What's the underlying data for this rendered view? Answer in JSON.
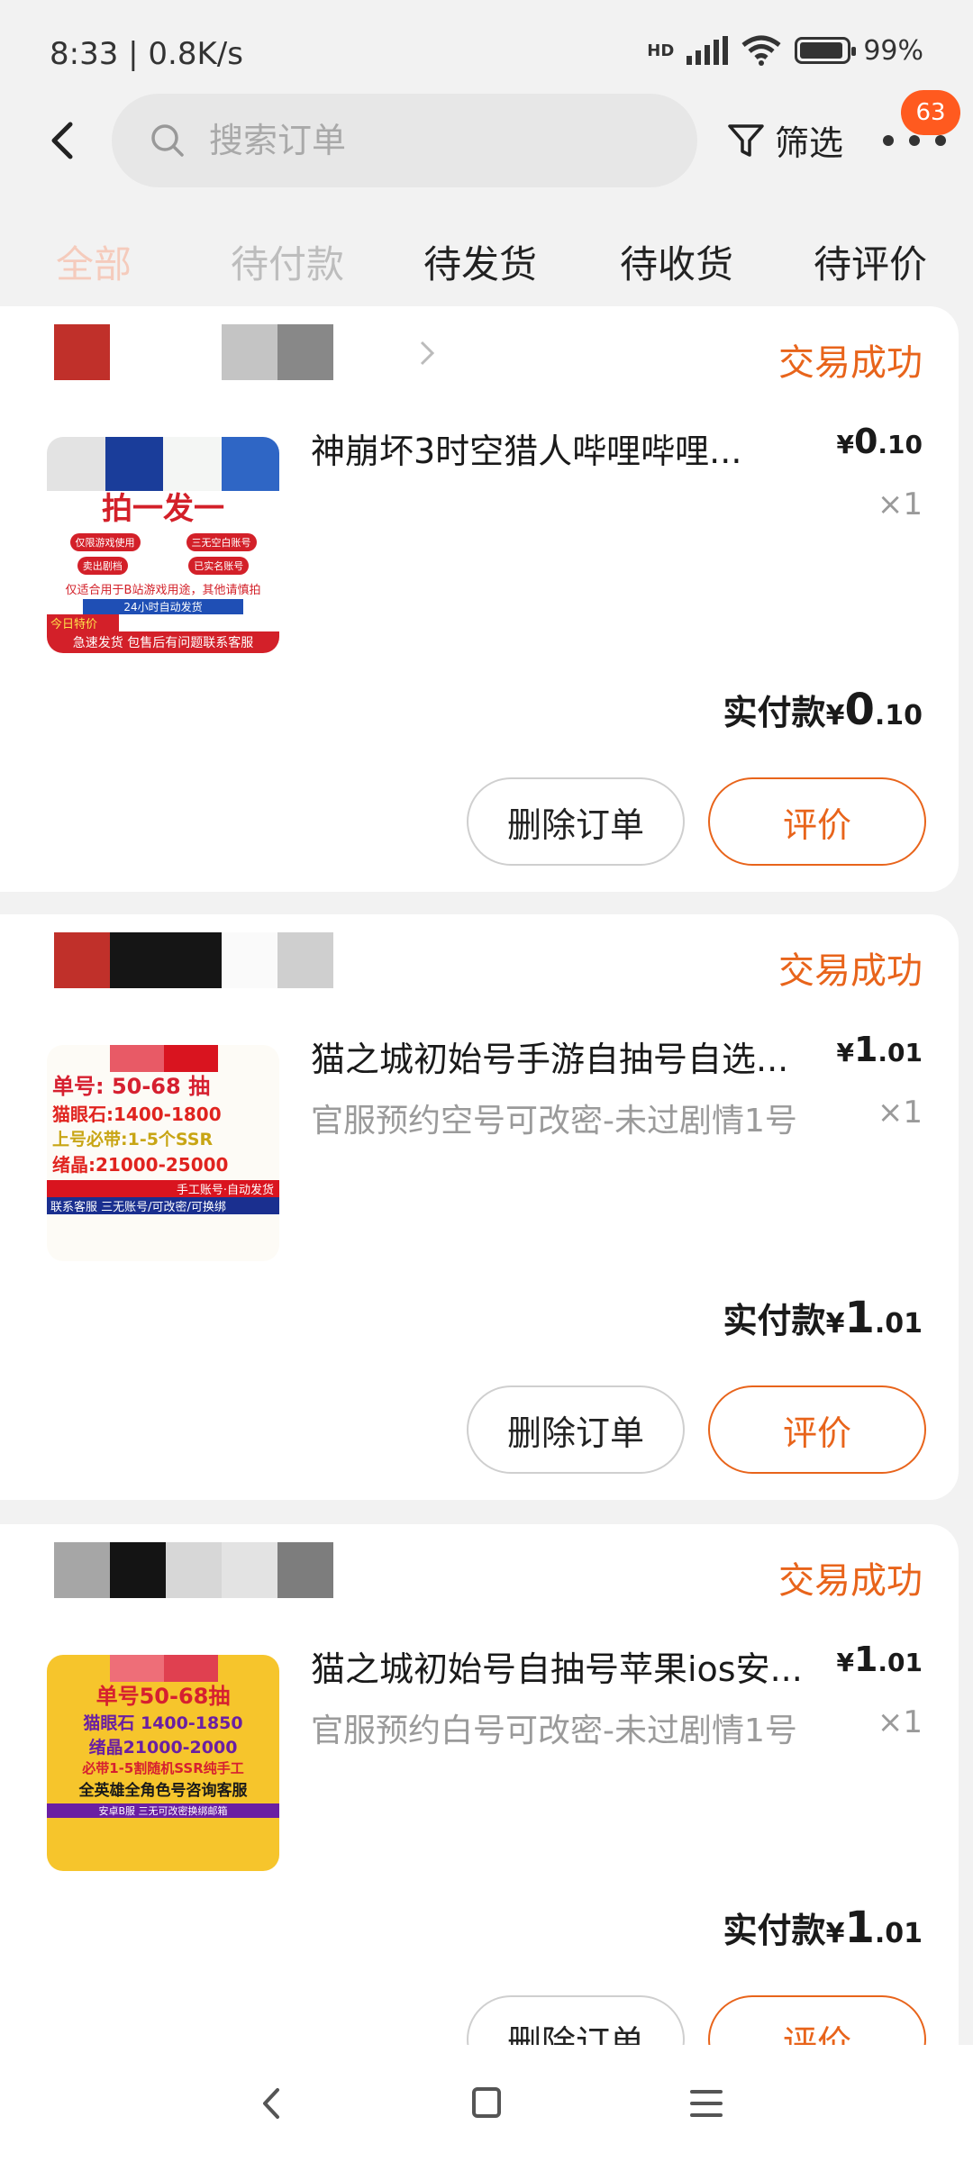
{
  "status_bar": {
    "time": "8:33 | 0.8K/s",
    "network": "HD",
    "battery": "99%"
  },
  "header": {
    "search_placeholder": "搜索订单",
    "filter_label": "筛选",
    "badge_count": "63"
  },
  "tabs": [
    {
      "label": "全部"
    },
    {
      "label": "待付款"
    },
    {
      "label": "待发货"
    },
    {
      "label": "待收货"
    },
    {
      "label": "待评价"
    }
  ],
  "orders": [
    {
      "status": "交易成功",
      "title": "神崩坏3时空猎人哔哩哔哩...",
      "subtitle": "",
      "price_symbol": "¥",
      "price_int": "0",
      "price_dec": ".10",
      "qty": "×1",
      "paid_label": "实付款",
      "paid_symbol": "¥",
      "paid_int": "0",
      "paid_dec": ".10",
      "delete_label": "删除订单",
      "rate_label": "评价",
      "thumb": {
        "line1": "拍一发一",
        "pill1": "仅限游戏使用",
        "pill2": "三无空白账号",
        "pill3": "卖出剧档",
        "pill4": "已实名账号",
        "note": "仅适合用于B站游戏用途，其他请慎拍",
        "banner": "24小时自动发货",
        "tag": "今日特价",
        "footer": "急速发货 包售后有问题联系客服"
      }
    },
    {
      "status": "交易成功",
      "title": "猫之城初始号手游自抽号自选...",
      "subtitle": "官服预约空号可改密-未过剧情1号",
      "price_symbol": "¥",
      "price_int": "1",
      "price_dec": ".01",
      "qty": "×1",
      "paid_label": "实付款",
      "paid_symbol": "¥",
      "paid_int": "1",
      "paid_dec": ".01",
      "delete_label": "删除订单",
      "rate_label": "评价",
      "thumb": {
        "line1": "单号: 50-68 抽",
        "line2": "猫眼石:1400-1800",
        "line3": "上号必带:1-5个SSR",
        "line4": "绪晶:21000-25000",
        "line5": "手工账号·自动发货",
        "line6": "联系客服 三无账号/可改密/可换绑"
      }
    },
    {
      "status": "交易成功",
      "title": "猫之城初始号自抽号苹果ios安...",
      "subtitle": "官服预约白号可改密-未过剧情1号",
      "price_symbol": "¥",
      "price_int": "1",
      "price_dec": ".01",
      "qty": "×1",
      "paid_label": "实付款",
      "paid_symbol": "¥",
      "paid_int": "1",
      "paid_dec": ".01",
      "delete_label": "删除订单",
      "rate_label": "评价",
      "thumb": {
        "line1": "单号50-68抽",
        "line2": "猫眼石 1400-1850",
        "line3": "绪晶21000-2000",
        "line4": "必带1-5割随机SSR纯手工",
        "line5": "全英雄全角色号咨询客服",
        "line6": "安卓B服 三无可改密换绑邮箱"
      }
    }
  ],
  "colors": {
    "accent": "#e8641b",
    "badge": "#ff5a1f",
    "background": "#f2f2f2"
  }
}
